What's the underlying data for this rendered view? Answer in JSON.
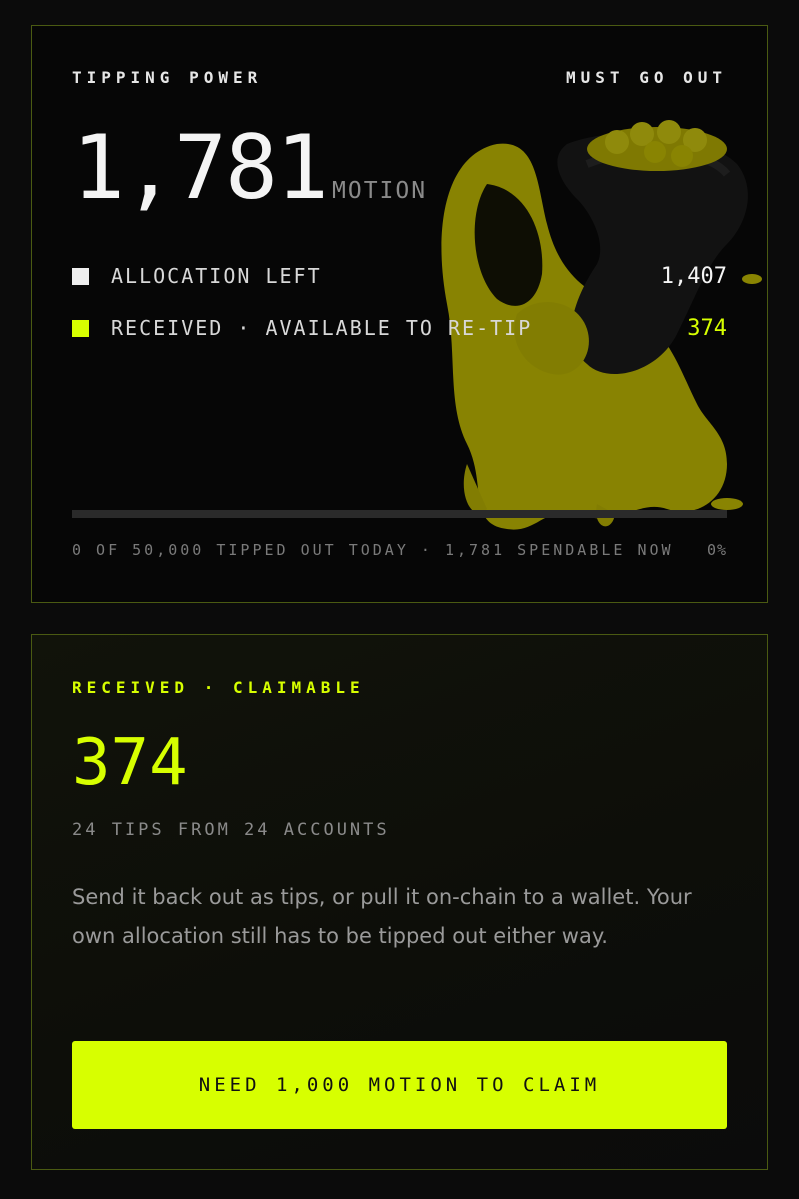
{
  "colors": {
    "accent": "#d7ff00",
    "allocation_swatch": "#eeeeee",
    "received_swatch": "#d7ff00",
    "card_border": "#4a5a12"
  },
  "tipping_card": {
    "label": "TIPPING POWER",
    "must_go_out": "MUST GO OUT",
    "value": "1,781",
    "unit": "MOTION",
    "mascot_icon": "mascot-with-coin-sack-icon",
    "legend": [
      {
        "label": "ALLOCATION LEFT",
        "value": "1,407"
      },
      {
        "label": "RECEIVED · AVAILABLE TO RE-TIP",
        "value": "374"
      }
    ],
    "progress_fraction": 0,
    "footer_text": "0 OF 50,000 TIPPED OUT TODAY · 1,781 SPENDABLE NOW",
    "footer_percent": "0%"
  },
  "claim_card": {
    "label": "RECEIVED · CLAIMABLE",
    "value": "374",
    "subtitle": "24 TIPS FROM 24 ACCOUNTS",
    "body": "Send it back out as tips, or pull it on-chain to a wallet. Your own allocation still has to be tipped out either way.",
    "button_label": "NEED 1,000 MOTION TO CLAIM"
  }
}
